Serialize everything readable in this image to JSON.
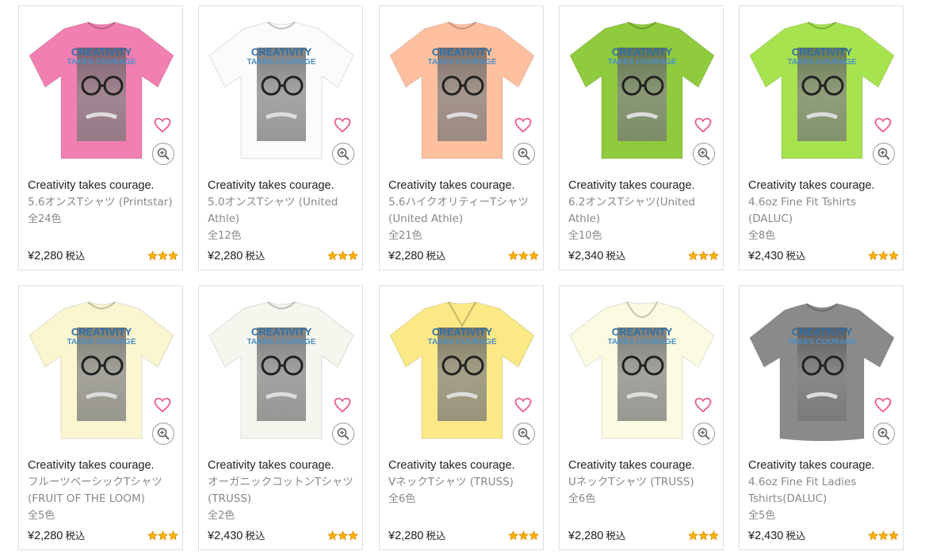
{
  "design": {
    "headline_line1": "CREATIVITY",
    "headline_line2": "TAKES COURAGE"
  },
  "products": [
    {
      "title": "Creativity takes courage.",
      "model": "5.6オンスTシャツ (Printstar)",
      "colors": "全24色",
      "price": "¥2,280",
      "tax": "税込",
      "shirt_color": "#f27fb1",
      "stars": 3,
      "style": "crew"
    },
    {
      "title": "Creativity takes courage.",
      "model": "5.0オンスTシャツ (United Athle)",
      "colors": "全12色",
      "price": "¥2,280",
      "tax": "税込",
      "shirt_color": "#fbfbfb",
      "stars": 3,
      "style": "crew"
    },
    {
      "title": "Creativity takes courage.",
      "model": "5.6ハイクオリティーTシャツ (United Athle)",
      "colors": "全21色",
      "price": "¥2,280",
      "tax": "税込",
      "shirt_color": "#ffc0a0",
      "stars": 3,
      "style": "crew"
    },
    {
      "title": "Creativity takes courage.",
      "model": "6.2オンスTシャツ(United Athle)",
      "colors": "全10色",
      "price": "¥2,340",
      "tax": "税込",
      "shirt_color": "#8fcb3c",
      "stars": 3,
      "style": "crew"
    },
    {
      "title": "Creativity takes courage.",
      "model": "4.6oz Fine Fit Tshirts (DALUC)",
      "colors": "全8色",
      "price": "¥2,430",
      "tax": "税込",
      "shirt_color": "#a6e34f",
      "stars": 3,
      "style": "crew"
    },
    {
      "title": "Creativity takes courage.",
      "model": "フルーツベーシックTシャツ (FRUIT OF THE LOOM)",
      "colors": "全5色",
      "price": "¥2,280",
      "tax": "税込",
      "shirt_color": "#fbf6d0",
      "stars": 3,
      "style": "crew"
    },
    {
      "title": "Creativity takes courage.",
      "model": "オーガニックコットンTシャツ (TRUSS)",
      "colors": "全2色",
      "price": "¥2,430",
      "tax": "税込",
      "shirt_color": "#f6f5ee",
      "stars": 3,
      "style": "crew"
    },
    {
      "title": "Creativity takes courage.",
      "model": "VネックTシャツ (TRUSS)",
      "colors": "全6色",
      "price": "¥2,280",
      "tax": "税込",
      "shirt_color": "#fbe985",
      "stars": 3,
      "style": "vneck"
    },
    {
      "title": "Creativity takes courage.",
      "model": "UネックTシャツ (TRUSS)",
      "colors": "全6色",
      "price": "¥2,280",
      "tax": "税込",
      "shirt_color": "#fbfbe2",
      "stars": 3,
      "style": "uneck"
    },
    {
      "title": "Creativity takes courage.",
      "model": "4.6oz Fine Fit Ladies Tshirts(DALUC)",
      "colors": "全5色",
      "price": "¥2,430",
      "tax": "税込",
      "shirt_color": "#8a8a8a",
      "stars": 3,
      "style": "ladies"
    }
  ],
  "icons": {
    "favorite": "heart-outline-icon",
    "zoom": "magnifier-plus-icon",
    "rating": "star-icon"
  },
  "colors": {
    "heart": "#ec5b94",
    "star": "#f5b400"
  }
}
